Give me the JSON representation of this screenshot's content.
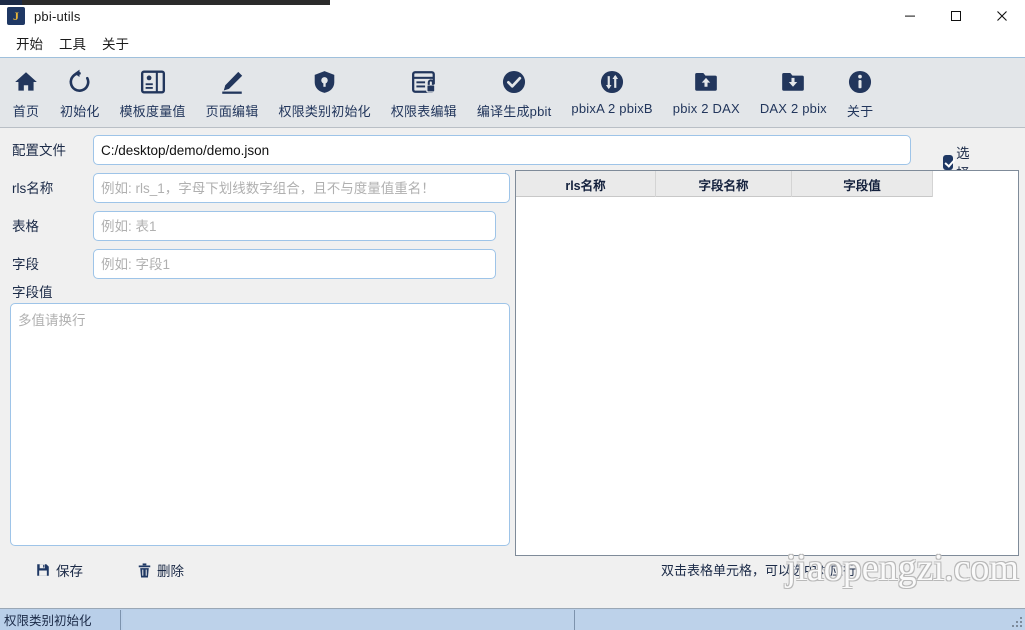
{
  "window": {
    "title": "pbi-utils",
    "app_icon_letter": "J",
    "icon_name": "app-icon",
    "controls": {
      "minimize": "minimize-icon",
      "maximize": "maximize-icon",
      "close": "close-icon"
    }
  },
  "menubar": {
    "items": [
      {
        "label": "开始",
        "name": "menu-start"
      },
      {
        "label": "工具",
        "name": "menu-tools"
      },
      {
        "label": "关于",
        "name": "menu-about"
      }
    ]
  },
  "toolbar": {
    "items": [
      {
        "label": "首页",
        "icon": "home-icon",
        "name": "toolbar-home"
      },
      {
        "label": "初始化",
        "icon": "refresh-icon",
        "name": "toolbar-init"
      },
      {
        "label": "模板度量值",
        "icon": "template-measure-icon",
        "name": "toolbar-template-measure"
      },
      {
        "label": "页面编辑",
        "icon": "pencil-icon",
        "name": "toolbar-page-edit"
      },
      {
        "label": "权限类别初始化",
        "icon": "shield-icon",
        "name": "toolbar-rls-category-init"
      },
      {
        "label": "权限表编辑",
        "icon": "table-lock-icon",
        "name": "toolbar-rls-table-edit"
      },
      {
        "label": "编译生成pbit",
        "icon": "check-circle-icon",
        "name": "toolbar-compile-pbit"
      },
      {
        "label": "pbixA 2 pbixB",
        "icon": "swap-circle-icon",
        "name": "toolbar-pbixa-2-pbixb"
      },
      {
        "label": "pbix 2 DAX",
        "icon": "folder-up-icon",
        "name": "toolbar-pbix-2-dax"
      },
      {
        "label": "DAX 2 pbix",
        "icon": "folder-down-icon",
        "name": "toolbar-dax-2-pbix"
      },
      {
        "label": "关于",
        "icon": "info-circle-icon",
        "name": "toolbar-about"
      }
    ]
  },
  "form": {
    "config_file": {
      "label": "配置文件",
      "value": "C:/desktop/demo/demo.json",
      "placeholder": ""
    },
    "rls_name": {
      "label": "rls名称",
      "value": "",
      "placeholder": "例如: rls_1，字母下划线数字组合，且不与度量值重名！"
    },
    "table": {
      "label": "表格",
      "value": "",
      "placeholder": "例如: 表1"
    },
    "field": {
      "label": "字段",
      "value": "",
      "placeholder": "例如: 字段1"
    },
    "field_value": {
      "label": "字段值",
      "value": "",
      "placeholder": "多值请换行"
    },
    "select_checkbox": {
      "label": "选择",
      "checked": true
    }
  },
  "table_panel": {
    "columns": [
      "rls名称",
      "字段名称",
      "字段值"
    ],
    "rows": []
  },
  "footer": {
    "save_label": "保存",
    "save_icon": "save-icon",
    "delete_label": "删除",
    "delete_icon": "trash-icon",
    "hint": "双击表格单元格，可以选中对应行。"
  },
  "watermark": {
    "text": "jiaopengzi.com"
  },
  "statusbar": {
    "text": "权限类别初始化",
    "progress_percent": 0
  },
  "colors": {
    "accent": "#22365c",
    "toolbar_bg": "#e3e6e9",
    "status_bg": "#b9cfe9",
    "input_border": "#9ec4e8",
    "icon_gold": "#e8b63a"
  }
}
